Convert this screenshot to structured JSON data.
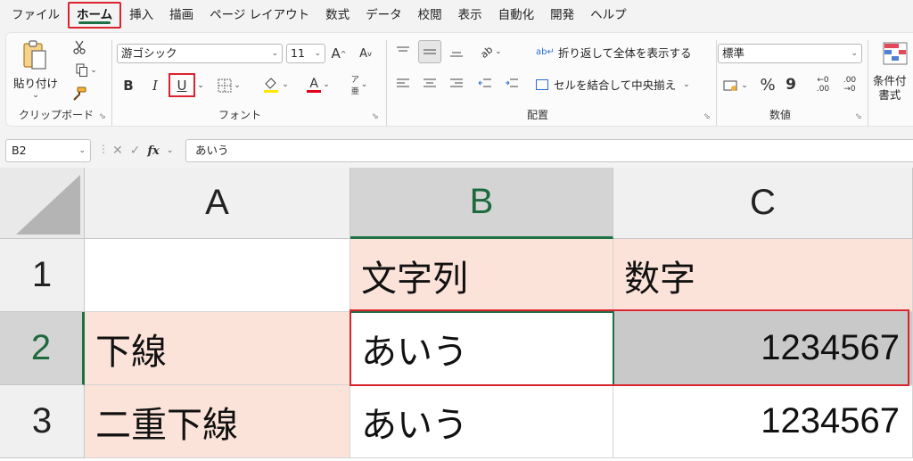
{
  "menu": {
    "tabs": [
      "ファイル",
      "ホーム",
      "挿入",
      "描画",
      "ページ レイアウト",
      "数式",
      "データ",
      "校閲",
      "表示",
      "自動化",
      "開発",
      "ヘルプ"
    ],
    "active_tab": "ホーム"
  },
  "ribbon": {
    "clipboard": {
      "paste_label": "貼り付け",
      "group_label": "クリップボード"
    },
    "font": {
      "font_name": "游ゴシック",
      "font_size": "11",
      "bold": "B",
      "italic": "I",
      "underline": "U",
      "font_color_letter": "A",
      "group_label": "フォント"
    },
    "alignment": {
      "wrap_text": "折り返して全体を表示する",
      "merge_center": "セルを結合して中央揃え",
      "group_label": "配置"
    },
    "number": {
      "format": "標準",
      "percent": "%",
      "comma": "9",
      "inc_decimal_top": "←0",
      "inc_decimal_bottom": ".00",
      "dec_decimal_top": ".00",
      "dec_decimal_bottom": "→0",
      "group_label": "数値"
    },
    "styles": {
      "conditional_line1": "条件付",
      "conditional_line2": "書式"
    }
  },
  "formula_bar": {
    "name_box": "B2",
    "fx": "fx",
    "content": "あいう"
  },
  "grid": {
    "columns": [
      "A",
      "B",
      "C"
    ],
    "rows": [
      "1",
      "2",
      "3"
    ],
    "cells": {
      "A1": "",
      "B1": "文字列",
      "C1": "数字",
      "A2": "下線",
      "B2": "あいう",
      "C2": "1234567",
      "A3": "二重下線",
      "B3": "あいう",
      "C3": "1234567"
    },
    "selected_cell": "B2"
  },
  "colors": {
    "accent_green": "#1e7145",
    "highlight_red": "#d9232d",
    "cell_pink": "#fbe3da",
    "cell_gray": "#c9c9c9"
  }
}
